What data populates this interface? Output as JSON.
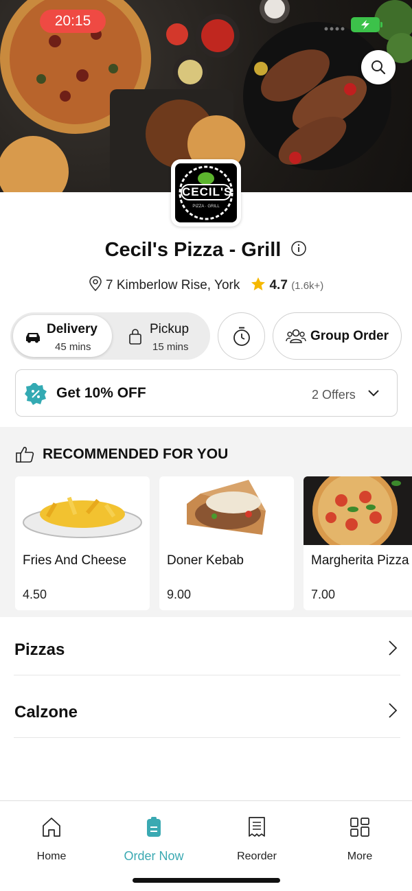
{
  "status_bar": {
    "time": "20:15"
  },
  "restaurant": {
    "name": "Cecil's Pizza - Grill",
    "address": "7 Kimberlow Rise, York",
    "rating": "4.7",
    "rating_count": "(1.6k+)",
    "logo_text": "CECIL'S",
    "logo_subtext": "PIZZA · GRILL"
  },
  "order_mode": {
    "delivery_label": "Delivery",
    "delivery_time": "45 mins",
    "pickup_label": "Pickup",
    "pickup_time": "15 mins",
    "selected": "Delivery",
    "group_order_label": "Group Order"
  },
  "offer": {
    "title": "Get 10% OFF",
    "count_label": "2 Offers",
    "badge_color": "#33aab3"
  },
  "recommended": {
    "heading": "RECOMMENDED FOR YOU",
    "items": [
      {
        "name": "Fries And Cheese",
        "price": "4.50"
      },
      {
        "name": "Doner Kebab",
        "price": "9.00"
      },
      {
        "name": "Margherita Pizza",
        "price": "7.00"
      }
    ]
  },
  "categories": [
    {
      "label": "Pizzas"
    },
    {
      "label": "Calzone"
    }
  ],
  "tabbar": {
    "tabs": [
      {
        "label": "Home",
        "icon": "home-icon"
      },
      {
        "label": "Order Now",
        "icon": "order-icon",
        "active": true
      },
      {
        "label": "Reorder",
        "icon": "receipt-icon"
      },
      {
        "label": "More",
        "icon": "grid-icon"
      }
    ],
    "accent_color": "#3aa9b2"
  }
}
